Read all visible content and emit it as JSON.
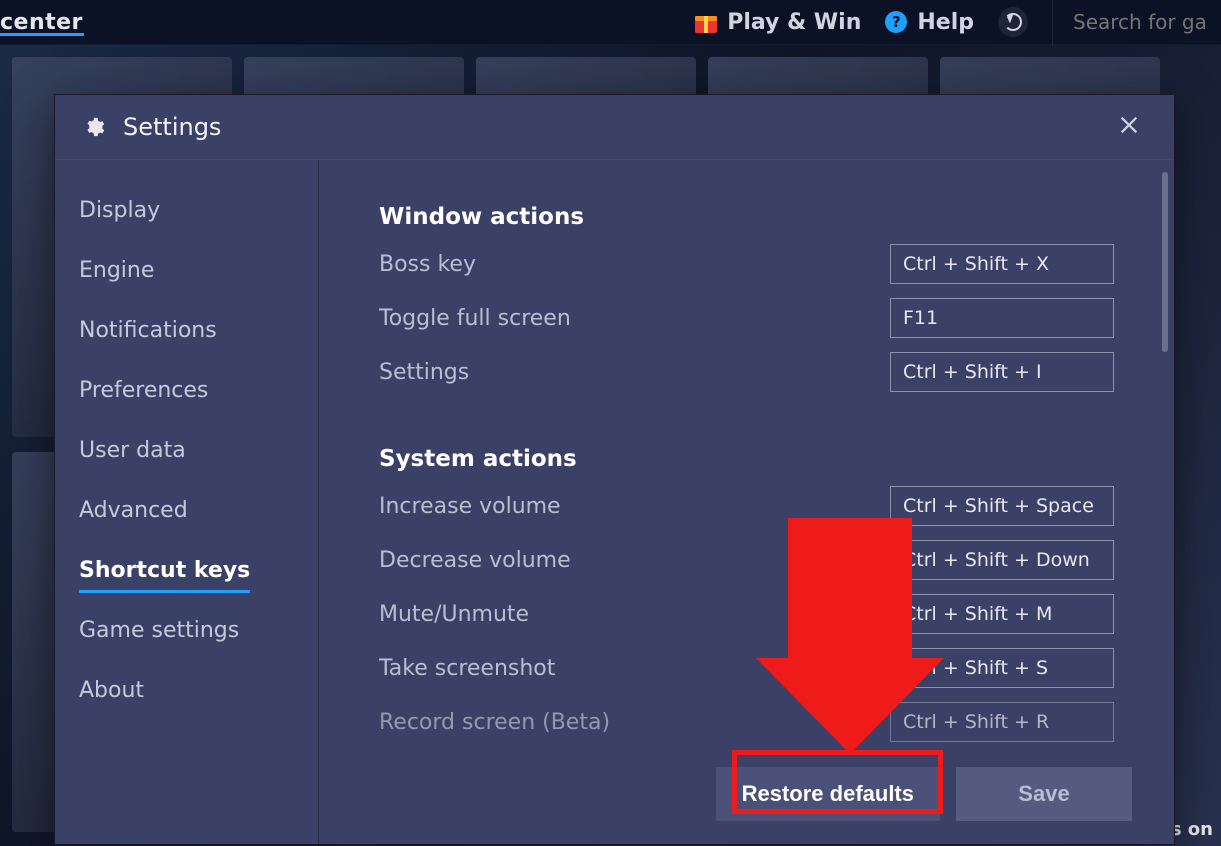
{
  "topbar": {
    "logo_tail": "center",
    "play_win_label": "Play & Win",
    "help_label": "Help",
    "search_placeholder": "Search for ga"
  },
  "background": {
    "bluestacks_fragment": "BlueStacks on"
  },
  "modal": {
    "title": "Settings"
  },
  "sidebar": {
    "items": [
      {
        "label": "Display"
      },
      {
        "label": "Engine"
      },
      {
        "label": "Notifications"
      },
      {
        "label": "Preferences"
      },
      {
        "label": "User data"
      },
      {
        "label": "Advanced"
      },
      {
        "label": "Shortcut keys"
      },
      {
        "label": "Game settings"
      },
      {
        "label": "About"
      }
    ],
    "active_index": 6
  },
  "panel": {
    "section1_title": "Window actions",
    "section2_title": "System actions",
    "rows1": [
      {
        "label": "Boss key",
        "shortcut": "Ctrl + Shift + X"
      },
      {
        "label": "Toggle full screen",
        "shortcut": "F11"
      },
      {
        "label": "Settings",
        "shortcut": "Ctrl + Shift + I"
      }
    ],
    "rows2": [
      {
        "label": "Increase volume",
        "shortcut": "Ctrl + Shift + Space"
      },
      {
        "label": "Decrease volume",
        "shortcut": "Ctrl + Shift + Down"
      },
      {
        "label": "Mute/Unmute",
        "shortcut": "Ctrl + Shift + M"
      },
      {
        "label": "Take screenshot",
        "shortcut": "Ctrl + Shift + S"
      },
      {
        "label": "Record screen (Beta)",
        "shortcut": "Ctrl + Shift + R"
      }
    ]
  },
  "footer": {
    "restore_label": "Restore defaults",
    "save_label": "Save"
  }
}
